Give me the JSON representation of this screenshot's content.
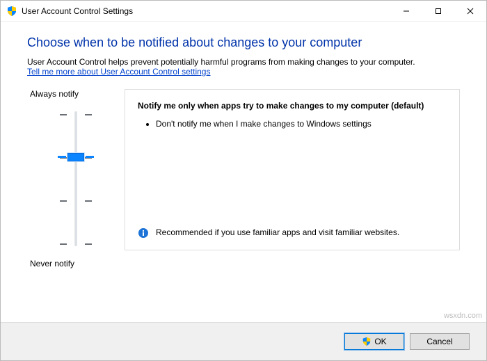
{
  "window": {
    "title": "User Account Control Settings"
  },
  "header": {
    "heading": "Choose when to be notified about changes to your computer",
    "helptext": "User Account Control helps prevent potentially harmful programs from making changes to your computer.",
    "link": "Tell me more about User Account Control settings"
  },
  "slider": {
    "topLabel": "Always notify",
    "bottomLabel": "Never notify",
    "levels": 4,
    "value": 2
  },
  "detail": {
    "title": "Notify me only when apps try to make changes to my computer (default)",
    "bullet1": "Don't notify me when I make changes to Windows settings",
    "recommendation": "Recommended if you use familiar apps and visit familiar websites."
  },
  "footer": {
    "ok": "OK",
    "cancel": "Cancel"
  },
  "watermark": "wsxdn.com"
}
